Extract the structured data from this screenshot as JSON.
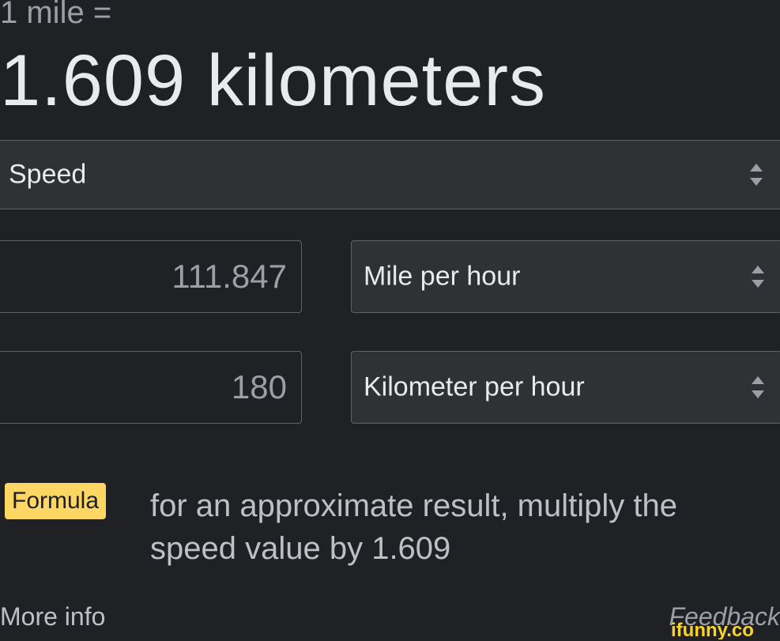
{
  "header": {
    "equation_label": "1 mile =",
    "result": "1.609 kilometers"
  },
  "category": {
    "selected": "Speed"
  },
  "converter": {
    "from": {
      "value": "111.847",
      "unit": "Mile per hour"
    },
    "to": {
      "value": "180",
      "unit": "Kilometer per hour"
    }
  },
  "formula": {
    "badge": "Formula",
    "text": "for an approximate result, multiply the speed value by 1.609"
  },
  "footer": {
    "more_info": "More info",
    "feedback": "Feedback"
  },
  "watermark": {
    "text": "ifunny.co"
  },
  "colors": {
    "background": "#202124",
    "select_background": "#303134",
    "border": "#5f6368",
    "formula_badge": "#fdd663",
    "watermark": "#f7d42a"
  },
  "icons": {
    "select_arrow": "unfold-updown-icon",
    "watermark_logo": "ifunny-logo"
  }
}
